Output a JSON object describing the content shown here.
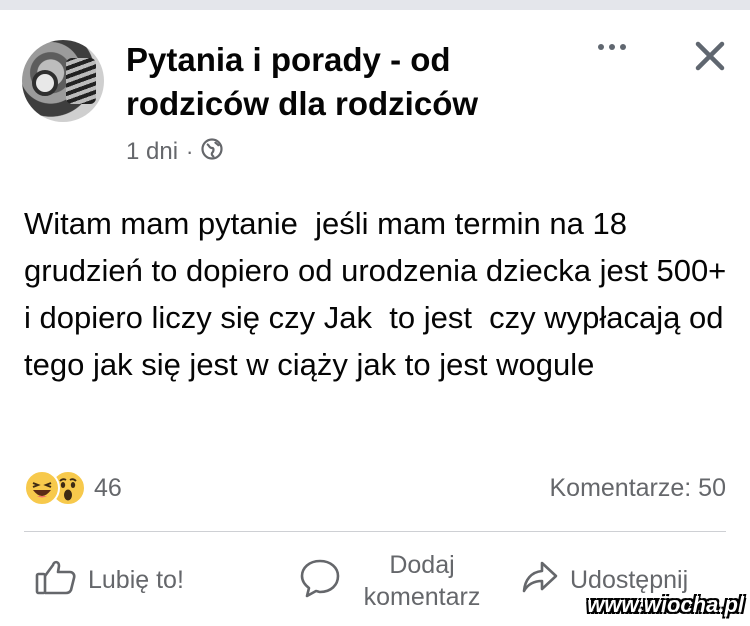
{
  "post": {
    "group_name": "Pytania i porady - od rodziców dla rodziców",
    "time_ago": "1 dni",
    "separator": "·",
    "privacy_icon": "globe-icon",
    "text": "Witam mam pytanie  jeśli mam termin na 18 grudzień to dopiero od urodzenia dziecka jest 500+  i dopiero liczy się czy Jak  to jest  czy wypłacają od tego jak się jest w ciąży jak to jest wogule",
    "reaction_count": "46",
    "reactions": [
      "haha-emoji",
      "wow-emoji"
    ],
    "comments_label": "Komentarze: 50"
  },
  "actions": {
    "like": "Lubię to!",
    "comment": "Dodaj komentarz",
    "share": "Udostępnij"
  },
  "watermark": "www.wiocha.pl",
  "colors": {
    "text": "#050505",
    "secondary": "#65676b",
    "divider": "#ced0d4",
    "emoji": "#f7c94c"
  }
}
